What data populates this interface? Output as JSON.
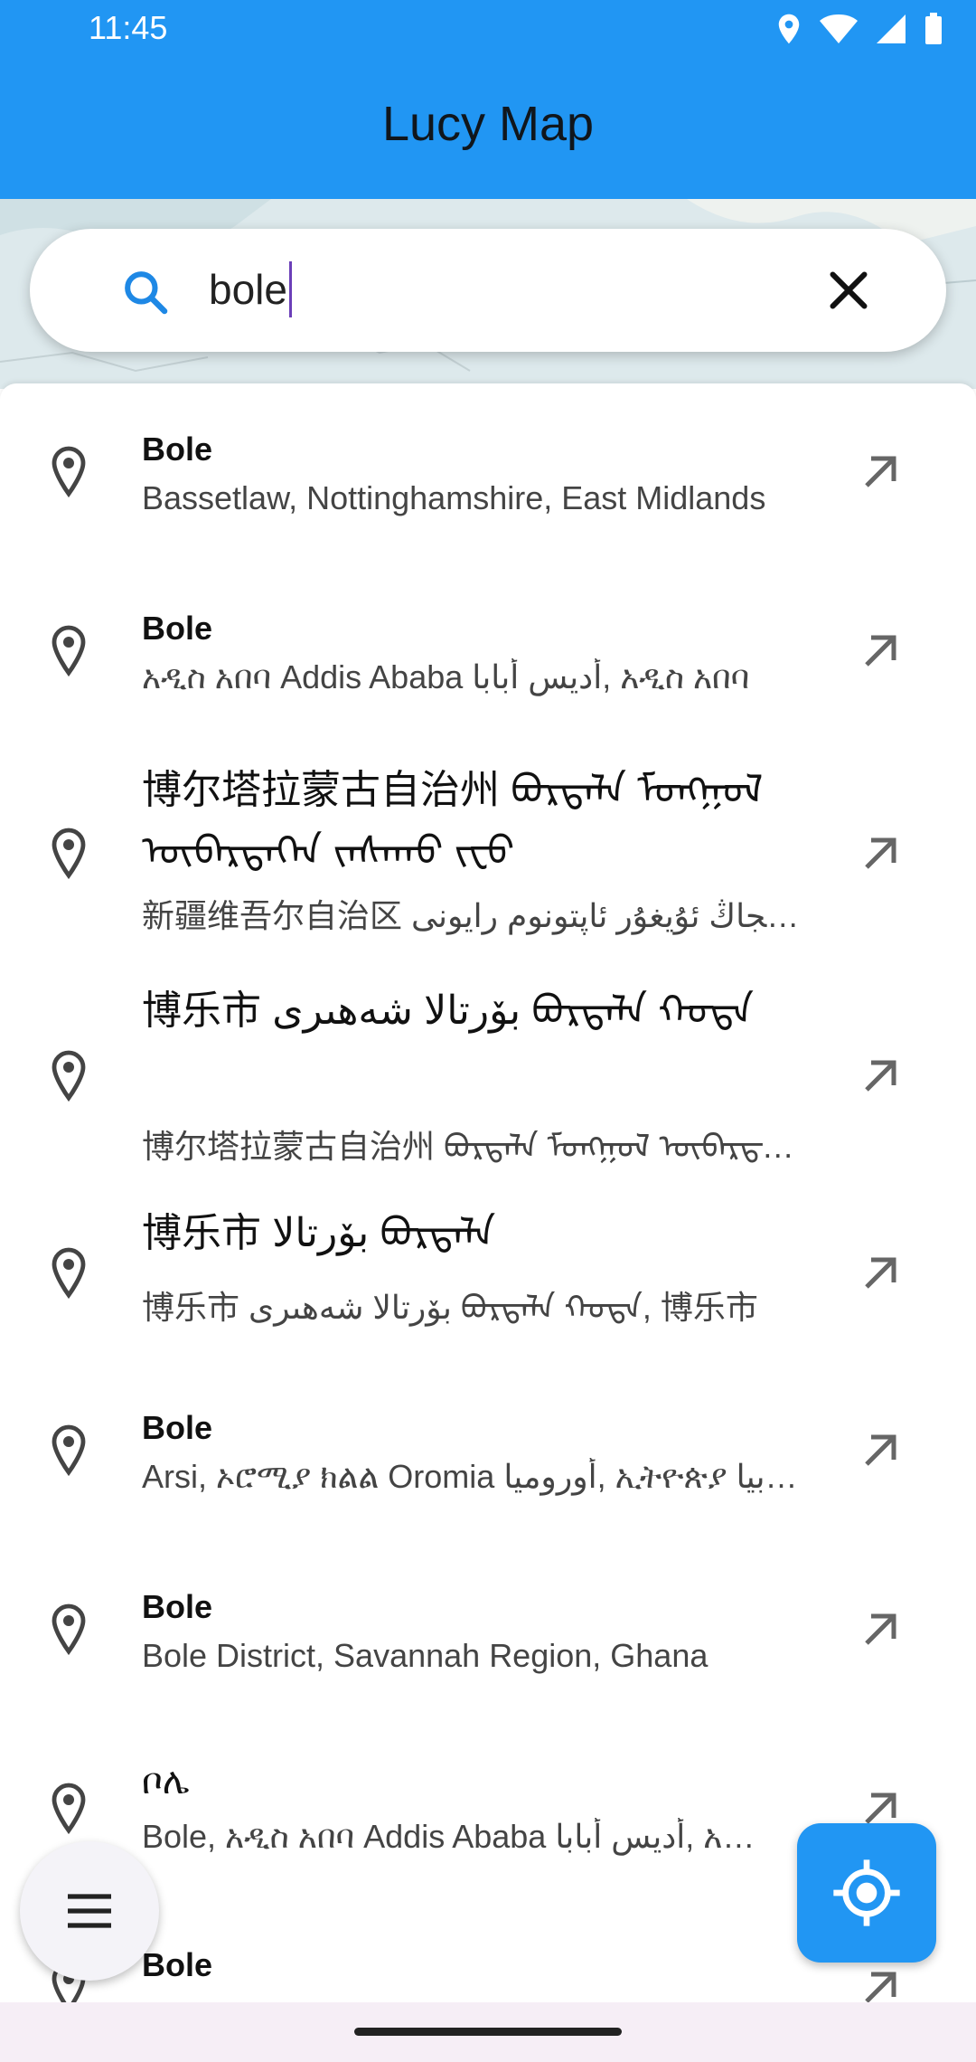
{
  "status_bar": {
    "time": "11:45"
  },
  "app_bar": {
    "title": "Lucy Map",
    "color": "#2196f3"
  },
  "search": {
    "value": "bole"
  },
  "results": [
    {
      "title": "Bole",
      "subtitle": "Bassetlaw, Nottinghamshire, East Midlands"
    },
    {
      "title": "Bole",
      "subtitle": "አዲስ አበባ Addis Ababa أديس أبابا, አዲስ አበባ"
    },
    {
      "title": "博尔塔拉蒙古自治州 ᠪᠣᠷᠲᠠᠯᠠ ᠮᠣᠩᠭᠣᠯ ᠥᠪᠡᠷᠲᠡᠭᠡᠨ ᠵᠠᠰᠠᠬᠣ ᠵᠧᠦ",
      "subtitle": "新疆维吾尔自治区 شىنجاڭ ئۇيغۇر ئاپتونوم رايونى"
    },
    {
      "title": "博乐市 بۆرتالا شەھىرى ᠪᠣᠷᠲᠠᠯᠠ ᠬᠣᠲᠠ",
      "subtitle": "博尔塔拉蒙古自治州 ᠪᠣᠷᠲᠠᠯᠠ ᠮᠣᠩᠭᠣᠯ ᠥᠪᠡᠷᠲᠡᠭᠡᠨ"
    },
    {
      "title": "博乐市 بۆرتالا ᠪᠣᠷᠲᠠᠯᠠ",
      "subtitle": "博乐市 بۆرتالا شەھىرى ᠪᠣᠷᠲᠠᠯᠠ ᠬᠣᠲᠠ, 博乐市"
    },
    {
      "title": "Bole",
      "subtitle": "Arsi, ኦሮሚያ ክልል Oromia أوروميا, ኢትዮጵያ إثيوبيا"
    },
    {
      "title": "Bole",
      "subtitle": "Bole District, Savannah Region, Ghana"
    },
    {
      "title": "ቦሌ",
      "subtitle": "Bole, አዲስ አበባ Addis Ababa أديس أبابا, አዲስ አበባ"
    },
    {
      "title": "Bole",
      "subtitle": ""
    }
  ]
}
